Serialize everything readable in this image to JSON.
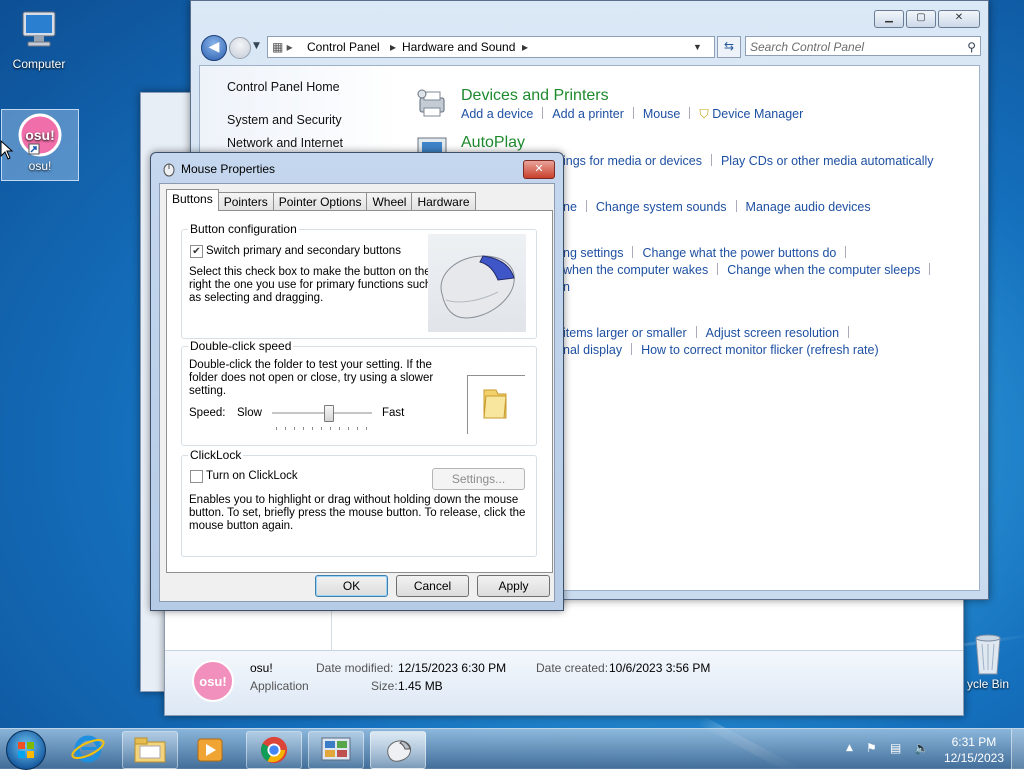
{
  "desktop": {
    "icons": [
      {
        "label": "Computer"
      },
      {
        "label": "osu!"
      },
      {
        "label": "ycle Bin"
      }
    ]
  },
  "control_panel": {
    "breadcrumb": [
      "Control Panel",
      "Hardware and Sound"
    ],
    "search_placeholder": "Search Control Panel",
    "left_links": [
      "Control Panel Home",
      "System and Security",
      "Network and Internet"
    ],
    "sections": {
      "devices": {
        "title": "Devices and Printers",
        "links": [
          "Add a device",
          "Add a printer",
          "Mouse",
          "Device Manager"
        ]
      },
      "autoplay": {
        "title": "AutoPlay",
        "links": [
          "ings for media or devices",
          "Play CDs or other media automatically"
        ]
      },
      "sound": {
        "links": [
          "ne",
          "Change system sounds",
          "Manage audio devices"
        ]
      },
      "power": {
        "links": [
          "ng settings",
          "Change what the power buttons do",
          "when the computer wakes",
          "Change when the computer sleeps",
          "n"
        ]
      },
      "display": {
        "links": [
          "items larger or smaller",
          "Adjust screen resolution",
          "nal display",
          "How to correct monitor flicker (refresh rate)"
        ]
      }
    }
  },
  "explorer": {
    "file_name": "osu!",
    "file_type": "Application",
    "date_modified_label": "Date modified:",
    "date_modified": "12/15/2023 6:30 PM",
    "date_created_label": "Date created:",
    "date_created": "10/6/2023 3:56 PM",
    "size_label": "Size:",
    "size": "1.45 MB"
  },
  "dialog": {
    "title": "Mouse Properties",
    "tabs": [
      "Buttons",
      "Pointers",
      "Pointer Options",
      "Wheel",
      "Hardware"
    ],
    "button_config": {
      "group_title": "Button configuration",
      "checkbox_label": "Switch primary and secondary buttons",
      "checked": true,
      "description_lines": [
        "Select this check box to make the button on the",
        "right the one you use for primary functions such",
        "as selecting and dragging."
      ]
    },
    "double_click": {
      "group_title": "Double-click speed",
      "description_lines": [
        "Double-click the folder to test your setting. If the",
        "folder does not open or close, try using a slower",
        "setting."
      ],
      "speed_label": "Speed:",
      "slow_label": "Slow",
      "fast_label": "Fast",
      "slider_value": 0.58
    },
    "clicklock": {
      "group_title": "ClickLock",
      "checkbox_label": "Turn on ClickLock",
      "checked": false,
      "settings_label": "Settings...",
      "description_lines": [
        "Enables you to highlight or drag without holding down the mouse",
        "button. To set, briefly press the mouse button. To release, click the",
        "mouse button again."
      ]
    },
    "buttons": {
      "ok": "OK",
      "cancel": "Cancel",
      "apply": "Apply"
    }
  },
  "taskbar": {
    "apps": [
      "start-icon",
      "internet-explorer-icon",
      "file-explorer-icon",
      "media-player-icon",
      "chrome-icon",
      "control-panel-icon",
      "mouse-icon"
    ],
    "time": "6:31 PM",
    "date": "12/15/2023"
  }
}
